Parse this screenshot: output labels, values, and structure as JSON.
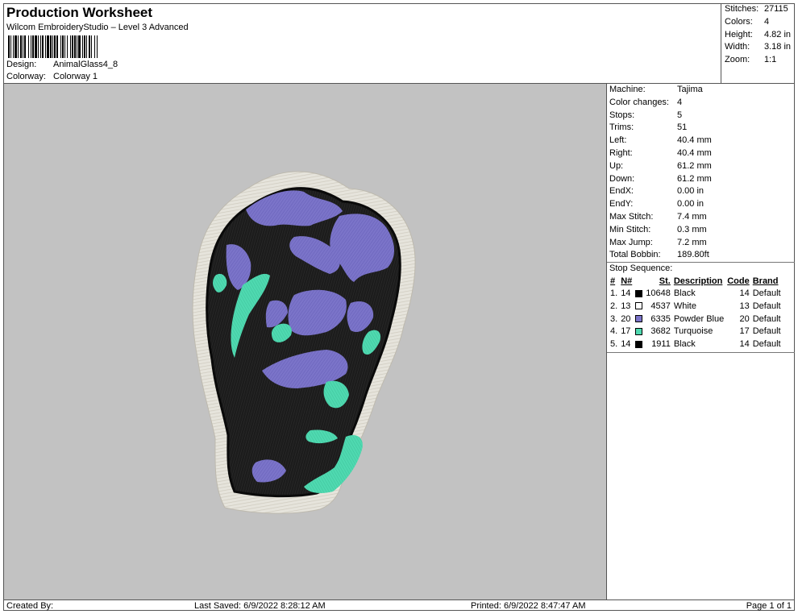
{
  "header": {
    "title": "Production Worksheet",
    "subtitle": "Wilcom EmbroideryStudio – Level 3 Advanced",
    "design_label": "Design:",
    "design_value": "AnimalGlass4_8",
    "colorway_label": "Colorway:",
    "colorway_value": "Colorway 1"
  },
  "stats": [
    {
      "k": "Stitches:",
      "v": "27115"
    },
    {
      "k": "Colors:",
      "v": "4"
    },
    {
      "k": "Height:",
      "v": "4.82 in"
    },
    {
      "k": "Width:",
      "v": "3.18 in"
    },
    {
      "k": "Zoom:",
      "v": "1:1"
    }
  ],
  "properties": [
    {
      "k": "Machine:",
      "v": "Tajima"
    },
    {
      "k": "Color changes:",
      "v": "4"
    },
    {
      "k": "Stops:",
      "v": "5"
    },
    {
      "k": "Trims:",
      "v": "51"
    },
    {
      "k": "Left:",
      "v": "40.4 mm"
    },
    {
      "k": "Right:",
      "v": "40.4 mm"
    },
    {
      "k": "Up:",
      "v": "61.2 mm"
    },
    {
      "k": "Down:",
      "v": "61.2 mm"
    },
    {
      "k": "EndX:",
      "v": "0.00 in"
    },
    {
      "k": "EndY:",
      "v": "0.00 in"
    },
    {
      "k": "Max Stitch:",
      "v": "7.4 mm"
    },
    {
      "k": "Min Stitch:",
      "v": "0.3 mm"
    },
    {
      "k": "Max Jump:",
      "v": "7.2 mm"
    },
    {
      "k": "Total Bobbin:",
      "v": "189.80ft"
    }
  ],
  "sequence": {
    "title": "Stop Sequence:",
    "headers": {
      "num": "#",
      "n": "N#",
      "st": "St.",
      "desc": "Description",
      "code": "Code",
      "brand": "Brand"
    },
    "rows": [
      {
        "num": "1.",
        "n": "14",
        "color": "#000000",
        "st": "10648",
        "desc": "Black",
        "code": "14",
        "brand": "Default"
      },
      {
        "num": "2.",
        "n": "13",
        "color": "#ffffff",
        "st": "4537",
        "desc": "White",
        "code": "13",
        "brand": "Default"
      },
      {
        "num": "3.",
        "n": "20",
        "color": "#7b74c9",
        "st": "6335",
        "desc": "Powder Blue",
        "code": "20",
        "brand": "Default"
      },
      {
        "num": "4.",
        "n": "17",
        "color": "#4fd9b0",
        "st": "3682",
        "desc": "Turquoise",
        "code": "17",
        "brand": "Default"
      },
      {
        "num": "5.",
        "n": "14",
        "color": "#000000",
        "st": "1911",
        "desc": "Black",
        "code": "14",
        "brand": "Default"
      }
    ]
  },
  "footer": {
    "created_by": "Created By:",
    "last_saved": "Last Saved: 6/9/2022 8:28:12 AM",
    "printed": "Printed: 6/9/2022 8:47:47 AM",
    "page": "Page 1 of 1"
  },
  "colors": {
    "canvas_bg": "#c2c2c2",
    "black": "#111111",
    "white_thread": "#e8e6df",
    "powder_blue": "#7b74c9",
    "turquoise": "#4fd9b0"
  }
}
